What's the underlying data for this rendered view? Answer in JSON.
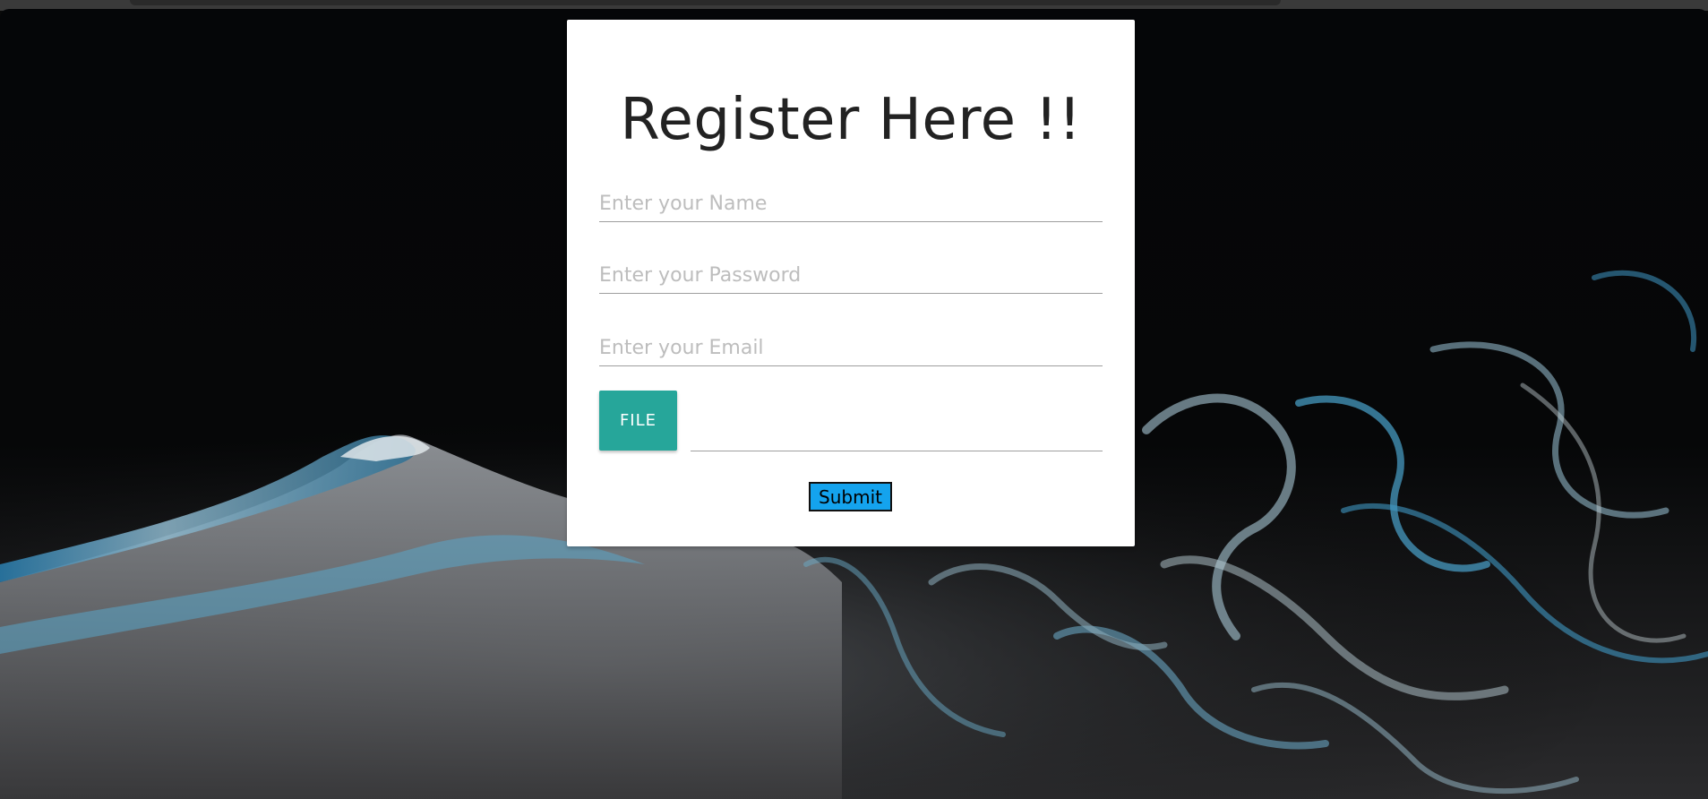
{
  "form": {
    "title": "Register Here !!",
    "name_placeholder": "Enter your Name",
    "password_placeholder": "Enter your Password",
    "email_placeholder": "Enter your Email",
    "file_button_label": "FILE",
    "file_path_value": "",
    "submit_label": "Submit"
  },
  "colors": {
    "file_button": "#26a69a",
    "submit_button": "#14a3ee",
    "card_background": "#ffffff",
    "page_background": "#0a0a0a"
  }
}
